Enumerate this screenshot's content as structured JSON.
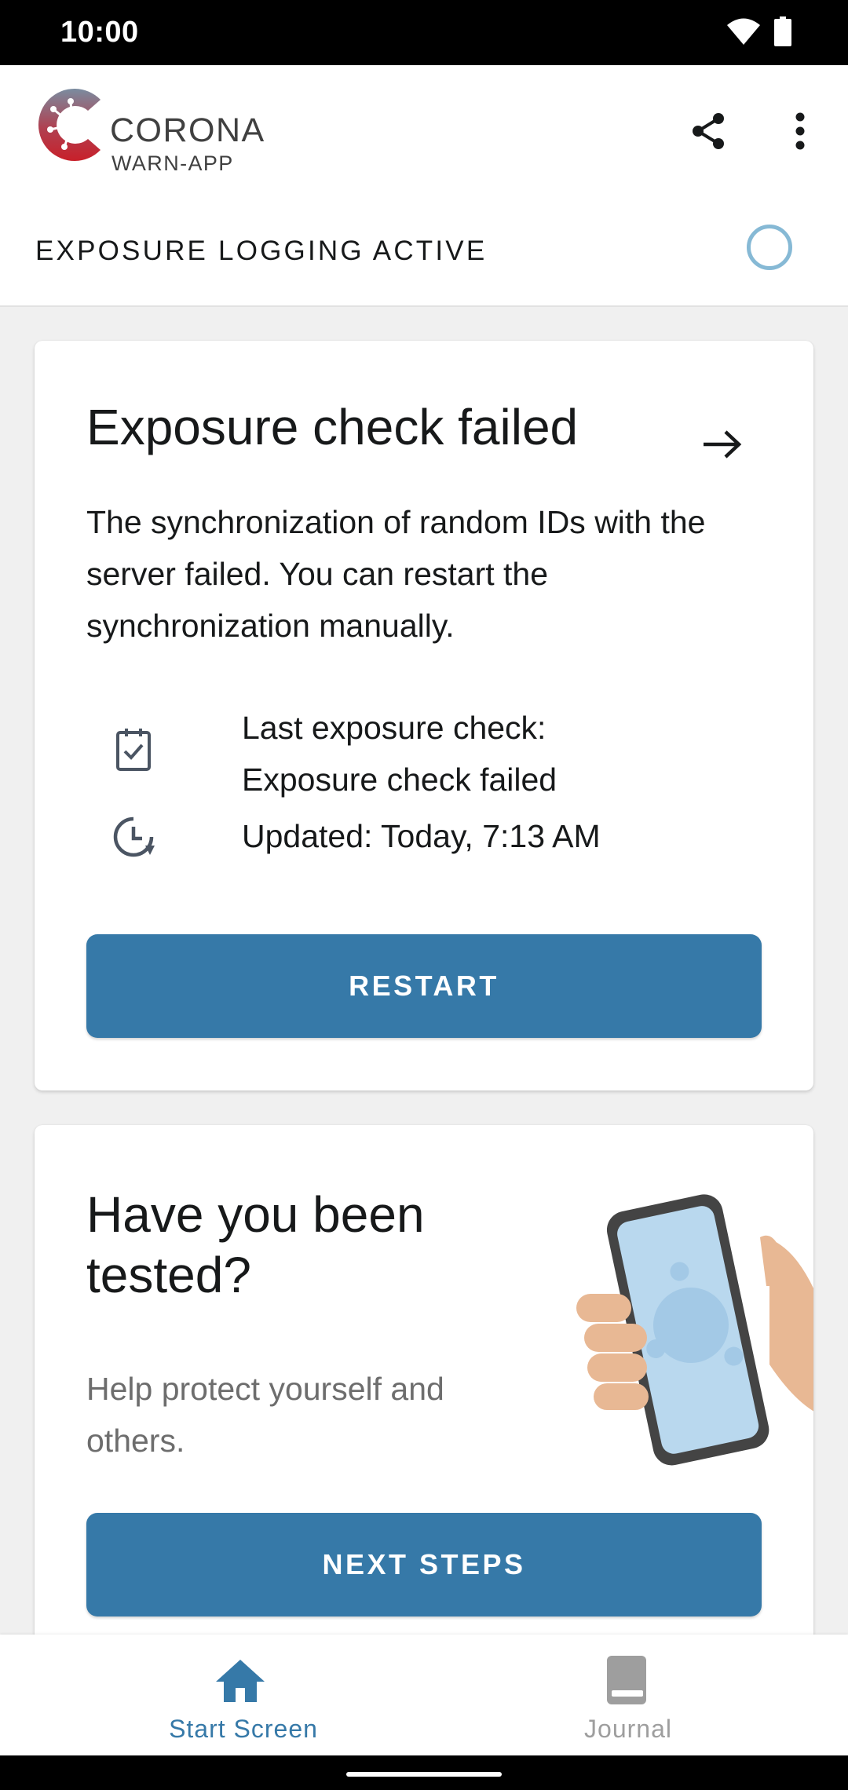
{
  "status_bar": {
    "time": "10:00",
    "icons": [
      "wifi-icon",
      "battery-icon"
    ]
  },
  "header": {
    "logo_title": "CORONA",
    "logo_subtitle": "WARN-APP",
    "actions": [
      "share-icon",
      "more-vert-icon"
    ]
  },
  "logging": {
    "label": "EXPOSURE LOGGING ACTIVE",
    "indicator_color": "#86b9d5"
  },
  "risk_card": {
    "title": "Exposure check failed",
    "body": "The synchronization of random IDs with the server failed. You can restart the synchronization manually.",
    "last_check_label": "Last exposure check:",
    "last_check_value": "Exposure check failed",
    "updated": "Updated: Today, 7:13 AM",
    "button_label": "RESTART"
  },
  "test_card": {
    "title": "Have you been tested?",
    "body": "Help protect yourself and others.",
    "button_label": "NEXT STEPS"
  },
  "bottom_nav": {
    "items": [
      {
        "label": "Start Screen",
        "icon": "home-icon",
        "active": true
      },
      {
        "label": "Journal",
        "icon": "book-icon",
        "active": false
      }
    ]
  },
  "colors": {
    "accent": "#3679a8",
    "inactive": "#9e9e9e",
    "text": "#17191a"
  }
}
